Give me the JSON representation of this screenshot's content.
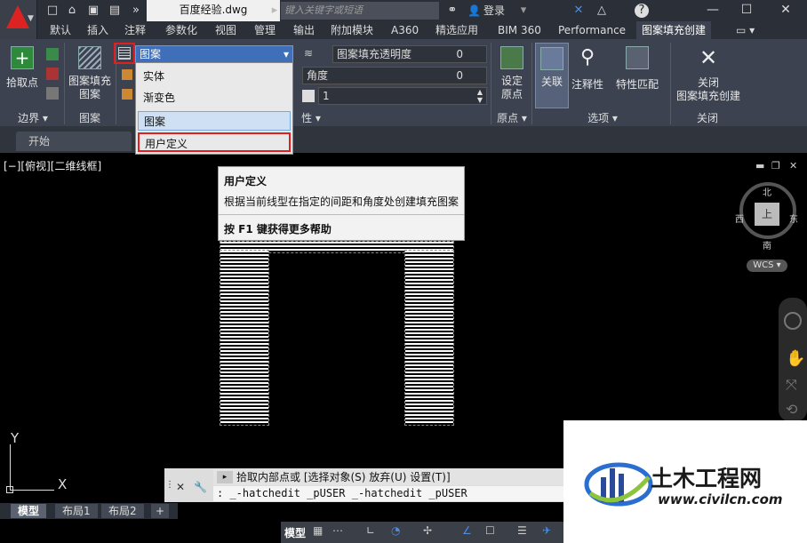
{
  "window": {
    "doc_title": "百度经验.dwg",
    "search_placeholder": "键入关键字或短语",
    "login": "登录",
    "help": "?"
  },
  "tabs": [
    "默认",
    "插入",
    "注释",
    "参数化",
    "视图",
    "管理",
    "输出",
    "附加模块",
    "A360",
    "精选应用",
    "BIM 360",
    "Performance",
    "图案填充创建"
  ],
  "active_tab": "图案填充创建",
  "ribbon": {
    "pick_point": "拾取点",
    "hatch_pattern": "图案填充\n图案",
    "pattern_combo": "图案",
    "transparency_label": "图案填充透明度",
    "transparency_value": "0",
    "angle_label": "角度",
    "angle_value": "0",
    "scale_value": "1",
    "set_origin": "设定\n原点",
    "associative": "关联",
    "annotative": "注释性",
    "match_props": "特性匹配",
    "close": "关闭\n图案填充创建",
    "panels": {
      "boundary": "边界",
      "pattern": "图案",
      "properties": "性",
      "origin": "原点",
      "options": "选项",
      "close": "关闭"
    }
  },
  "dropdown": {
    "items": [
      "实体",
      "渐变色",
      "图案",
      "用户定义"
    ],
    "selected": "图案",
    "highlighted": "用户定义"
  },
  "filetabs": {
    "start": "开始"
  },
  "viewport": {
    "label": "[−][俯视][二维线框]"
  },
  "tooltip": {
    "title": "用户定义",
    "desc": "根据当前线型在指定的间距和角度处创建填充图案",
    "help": "按 F1 键获得更多帮助"
  },
  "navcube": {
    "top": "上",
    "north": "北",
    "south": "南",
    "east": "东",
    "west": "西",
    "wcs": "WCS"
  },
  "command": {
    "prompt": "拾取内部点或 [选择对象(S) 放弃(U) 设置(T)]",
    "history": ": _-hatchedit _pUSER _-hatchedit _pUSER"
  },
  "layout_tabs": [
    "模型",
    "布局1",
    "布局2"
  ],
  "status": {
    "model": "模型"
  },
  "ucs": {
    "y": "Y",
    "x": "X"
  },
  "watermark": {
    "title": "土木工程网",
    "url": "www.civilcn.com"
  },
  "colors": {
    "accent_red": "#d32020",
    "ribbon_bg": "#3c4250",
    "hatch": "#ffffff"
  }
}
